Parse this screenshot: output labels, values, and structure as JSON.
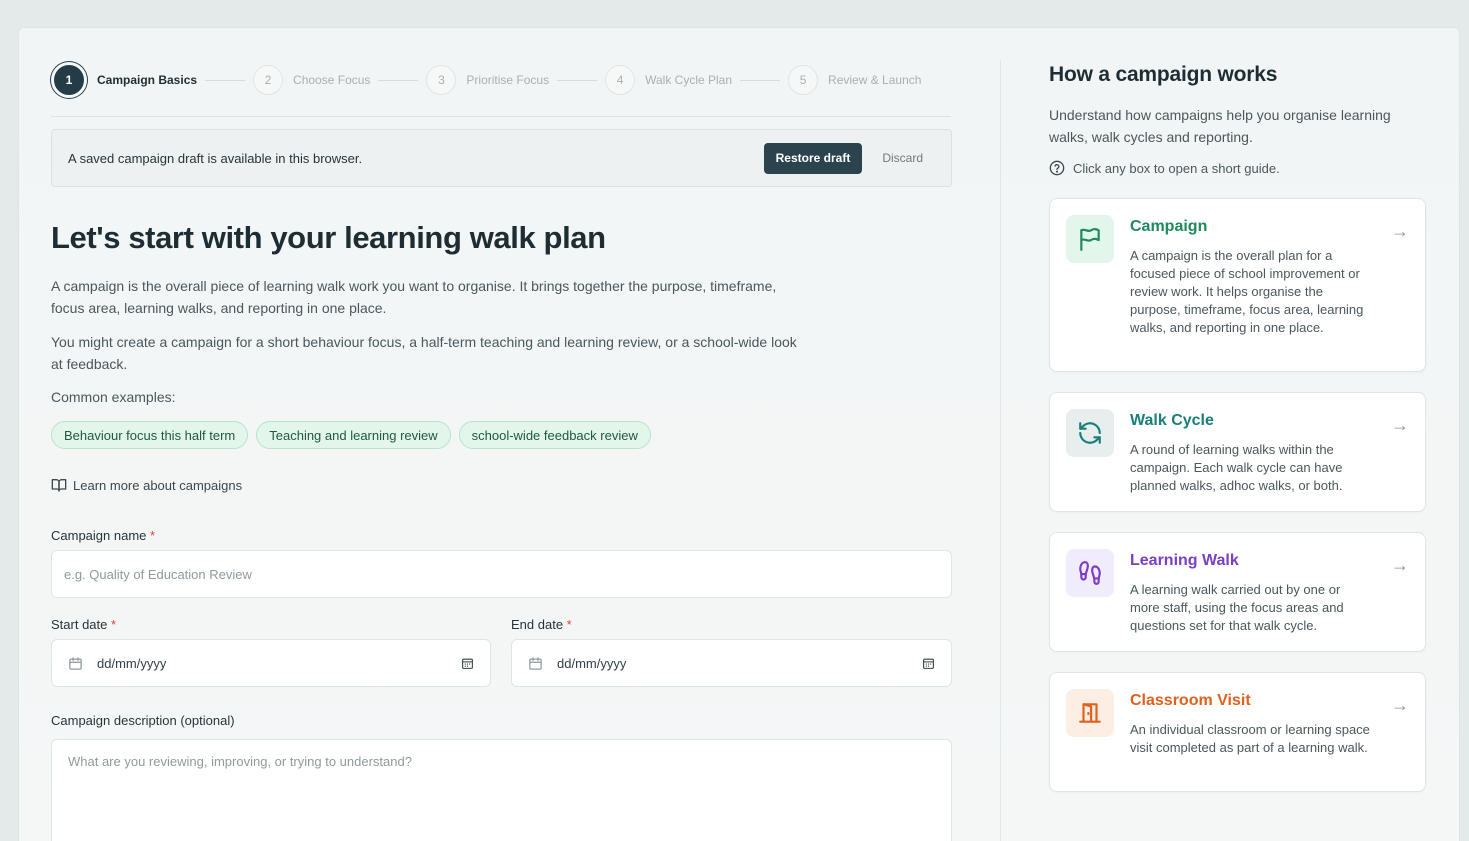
{
  "stepper": {
    "steps": [
      {
        "num": "1",
        "label": "Campaign Basics"
      },
      {
        "num": "2",
        "label": "Choose Focus"
      },
      {
        "num": "3",
        "label": "Prioritise Focus"
      },
      {
        "num": "4",
        "label": "Walk Cycle Plan"
      },
      {
        "num": "5",
        "label": "Review & Launch"
      }
    ],
    "active_step": 1
  },
  "draft_notice": {
    "text": "A saved campaign draft is available in this browser.",
    "restore_label": "Restore draft",
    "discard_label": "Discard"
  },
  "main": {
    "title": "Let's start with your learning walk plan",
    "paragraph1": "A campaign is the overall piece of learning walk work you want to organise. It brings together the purpose, timeframe, focus area, learning walks, and reporting in one place.",
    "paragraph2": "You might create a campaign for a short behaviour focus, a half-term teaching and learning review, or a school-wide look at feedback.",
    "examples_label": "Common examples:",
    "examples": [
      "Behaviour focus this half term",
      "Teaching and learning review",
      "school-wide feedback review"
    ],
    "learn_more": "Learn more about campaigns"
  },
  "form": {
    "name_label": "Campaign name",
    "name_placeholder": "e.g. Quality of Education Review",
    "required_mark": "*",
    "start_label": "Start date",
    "start_value": "dd/mm/yyyy",
    "end_label": "End date",
    "end_value": "dd/mm/yyyy",
    "description_label": "Campaign description (optional)",
    "description_placeholder": "What are you reviewing, improving, or trying to understand?"
  },
  "sidebar": {
    "title": "How a campaign works",
    "subtitle": "Understand how campaigns help you organise learning walks, walk cycles and reporting.",
    "hint": "Click any box to open a short guide.",
    "cards": [
      {
        "title": "Campaign",
        "icon": "flag-icon",
        "color": "#1e8a5c",
        "bg": "#e3f6ec",
        "desc": "A campaign is the overall plan for a focused piece of school improvement or review work. It helps organise the purpose, timeframe, focus area, learning walks, and reporting in one place."
      },
      {
        "title": "Walk Cycle",
        "icon": "refresh-icon",
        "color": "#1a7f7a",
        "bg": "#e8eeee",
        "desc": "A round of learning walks within the campaign. Each walk cycle can have planned walks, adhoc walks, or both."
      },
      {
        "title": "Learning Walk",
        "icon": "footprints-icon",
        "color": "#7a3fc4",
        "bg": "#f1ecfb",
        "desc": "A learning walk carried out by one or more staff, using the focus areas and questions set for that walk cycle."
      },
      {
        "title": "Classroom Visit",
        "icon": "door-icon",
        "color": "#e0601d",
        "bg": "#fdeee4",
        "desc": "An individual classroom or learning space visit completed as part of a learning walk."
      }
    ],
    "arrow": "→"
  }
}
